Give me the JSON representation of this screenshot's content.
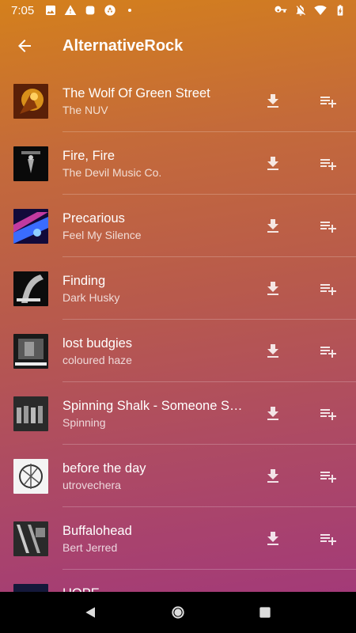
{
  "status_bar": {
    "time": "7:05",
    "left_icons": [
      "image-icon",
      "warning-icon",
      "app-icon",
      "aperture-icon",
      "dot-icon"
    ],
    "right_icons": [
      "vpn-key-icon",
      "bell-off-icon",
      "wifi-icon",
      "battery-charging-icon"
    ]
  },
  "app_bar": {
    "title": "AlternativeRock",
    "back_icon": "arrow-back-icon"
  },
  "tracks": [
    {
      "title": "The Wolf Of Green Street",
      "artist": "The NUV",
      "art_colors": [
        "#6a2a08",
        "#d8901a"
      ]
    },
    {
      "title": "Fire, Fire",
      "artist": "The Devil Music Co.",
      "art_colors": [
        "#0a0a0a",
        "#555555"
      ]
    },
    {
      "title": "Precarious",
      "artist": "Feel My Silence",
      "art_colors": [
        "#120a3a",
        "#4a8cff"
      ]
    },
    {
      "title": "Finding",
      "artist": "Dark Husky",
      "art_colors": [
        "#0c0c0c",
        "#bbbbbb"
      ]
    },
    {
      "title": "lost budgies",
      "artist": "coloured haze",
      "art_colors": [
        "#1a1a1a",
        "#9a9a9a"
      ]
    },
    {
      "title": "Spinning Shalk - Someone Spinning",
      "artist": "Spinning",
      "art_colors": [
        "#2a2a2a",
        "#aaaaaa"
      ]
    },
    {
      "title": "before the day",
      "artist": "utrovechera",
      "art_colors": [
        "#f4f4f4",
        "#333333"
      ]
    },
    {
      "title": "Buffalohead",
      "artist": "Bert Jerred",
      "art_colors": [
        "#2a2a2a",
        "#cccccc"
      ]
    },
    {
      "title": "HOPE",
      "artist": "",
      "art_colors": [
        "#14183a",
        "#5060a0"
      ]
    }
  ],
  "row_actions": {
    "download_icon": "download-icon",
    "playlist_icon": "playlist-add-icon"
  },
  "nav_bar": {
    "buttons": [
      "back-triangle-icon",
      "home-circle-icon",
      "recents-square-icon"
    ]
  }
}
